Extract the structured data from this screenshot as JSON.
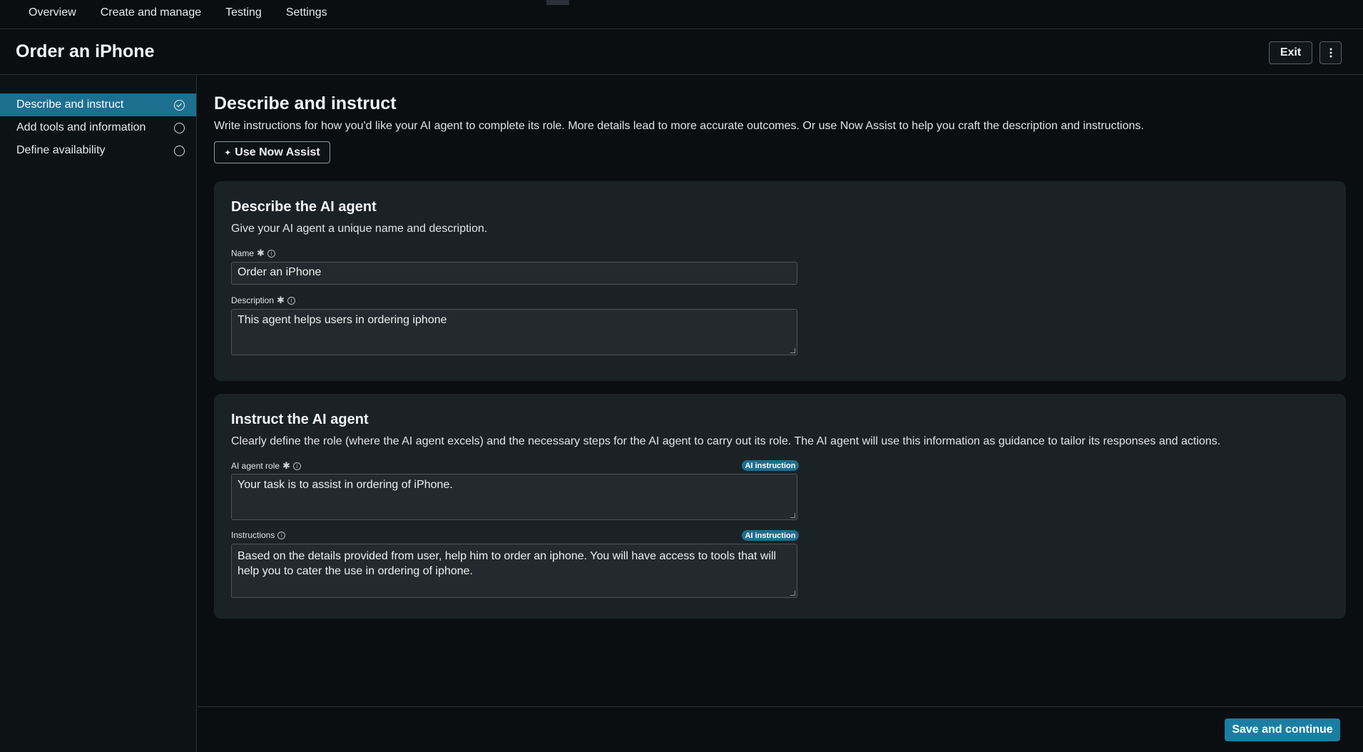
{
  "topnav": {
    "items": [
      "Overview",
      "Create and manage",
      "Testing",
      "Settings"
    ]
  },
  "header": {
    "title": "Order an iPhone",
    "exit_label": "Exit",
    "more_icon": "more-vertical-icon"
  },
  "sidebar": {
    "items": [
      {
        "label": "Describe and instruct",
        "state": "active"
      },
      {
        "label": "Add tools and information",
        "state": "pending"
      },
      {
        "label": "Define availability",
        "state": "pending"
      }
    ]
  },
  "main": {
    "title": "Describe and instruct",
    "description": "Write instructions for how you'd like your AI agent to complete its role. More details lead to more accurate outcomes. Or use Now Assist to help you craft the description and instructions.",
    "assist_label": "Use Now Assist",
    "describe_card": {
      "title": "Describe the AI agent",
      "description": "Give your AI agent a unique name and description.",
      "name_label": "Name",
      "name_value": "Order an iPhone",
      "description_label": "Description",
      "description_value": "This agent helps users in ordering iphone"
    },
    "instruct_card": {
      "title": "Instruct the AI agent",
      "description": "Clearly define the role (where the AI agent excels) and the necessary steps for the AI agent to carry out its role. The AI agent will use this information as guidance to tailor its responses and actions.",
      "role_label": "AI agent role",
      "role_value": "Your task is to assist in ordering of iPhone.",
      "instructions_label": "Instructions",
      "instructions_value": "Based on the details provided from user, help him to order an iphone. You will have access to tools that will help you to cater the use in ordering of iphone.",
      "badge_label": "AI instruction"
    }
  },
  "footer": {
    "save_label": "Save and continue"
  },
  "colors": {
    "accent": "#1d6f8f",
    "save_button": "#1a7ea3",
    "background": "#0a0e10",
    "card": "#1b2226"
  }
}
